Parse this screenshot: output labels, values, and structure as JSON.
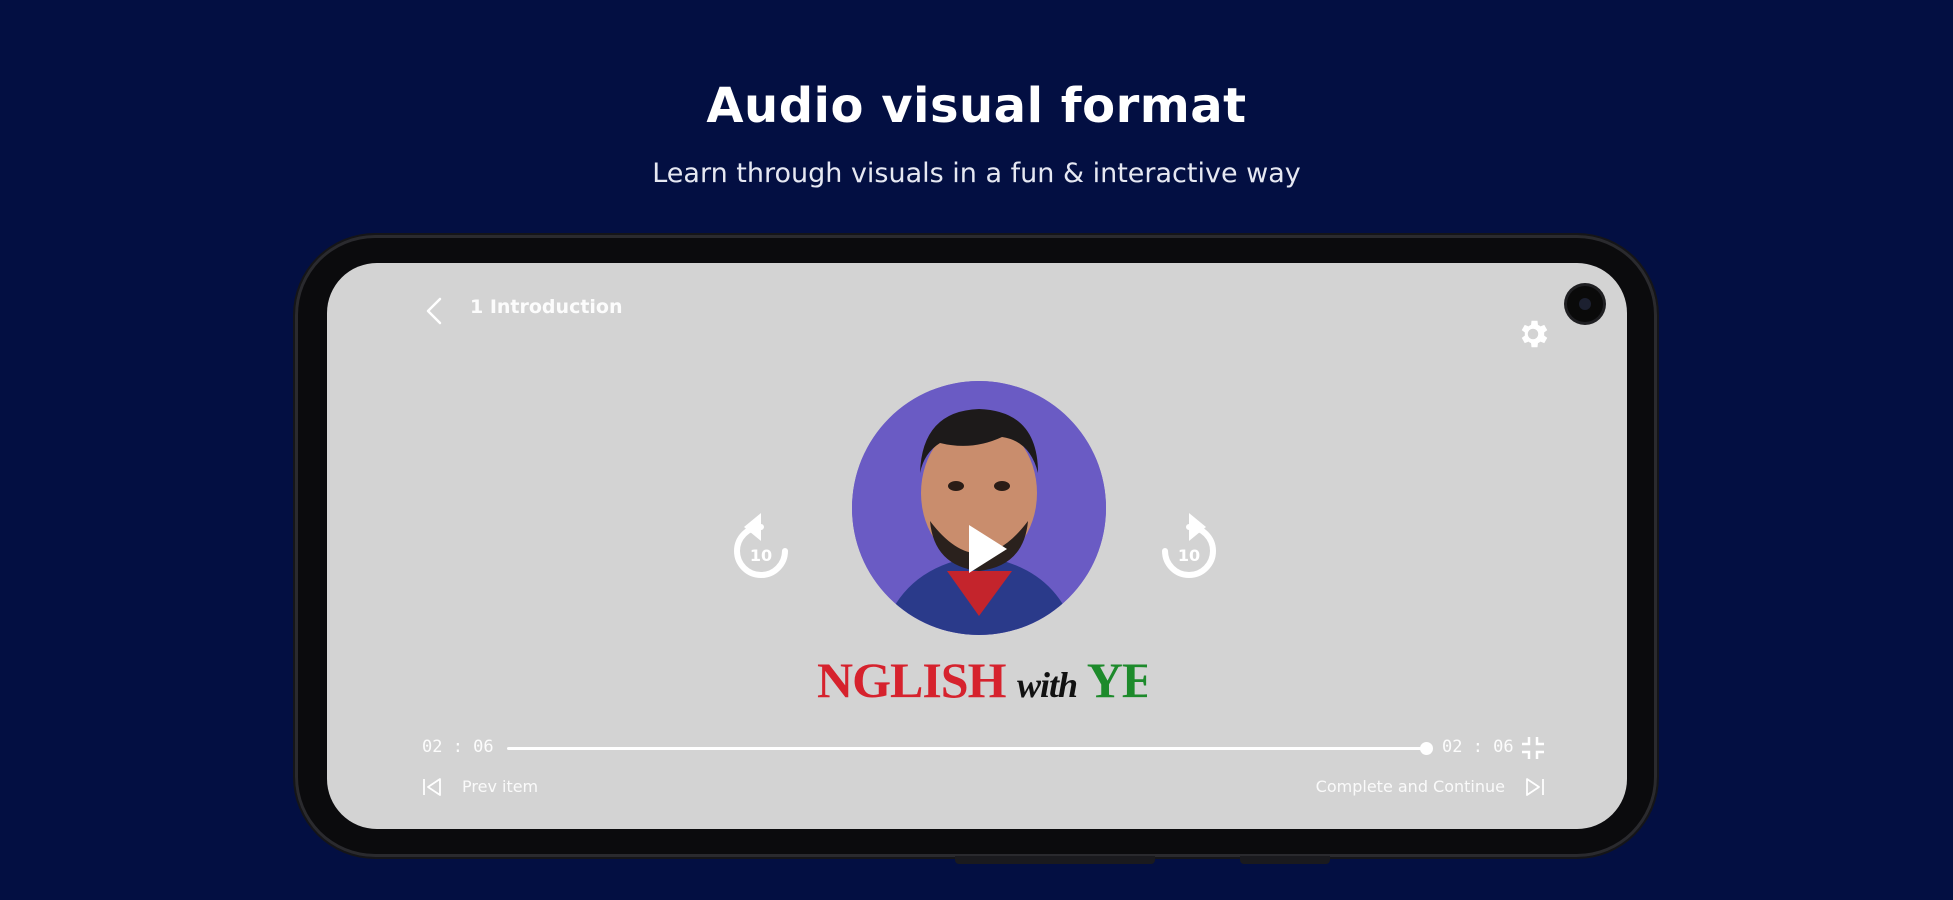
{
  "banner": {
    "title": "Audio visual format",
    "subtitle": "Learn through visuals in a fun & interactive way"
  },
  "player": {
    "lesson_title": "1 Introduction",
    "brand": {
      "part1": "NGLISH",
      "part2": "with",
      "part3": "YEASI"
    },
    "current_time": "02 : 06",
    "total_time": "02 : 06",
    "progress": 1.0,
    "skip_seconds": "10",
    "prev_label": "Prev item",
    "next_label": "Complete and Continue"
  },
  "icons": {
    "back": "chevron-left-icon",
    "settings": "gear-icon",
    "play": "play-icon",
    "rewind": "rewind-10-icon",
    "forward": "forward-10-icon",
    "fullscreen": "fullscreen-icon",
    "prev": "skip-previous-icon",
    "next": "skip-next-icon"
  },
  "colors": {
    "background": "#030f42",
    "screen": "#d3d3d3",
    "avatar_bg": "#6a5bc4",
    "brand_red": "#d6222d",
    "brand_green": "#1d8a2b"
  }
}
